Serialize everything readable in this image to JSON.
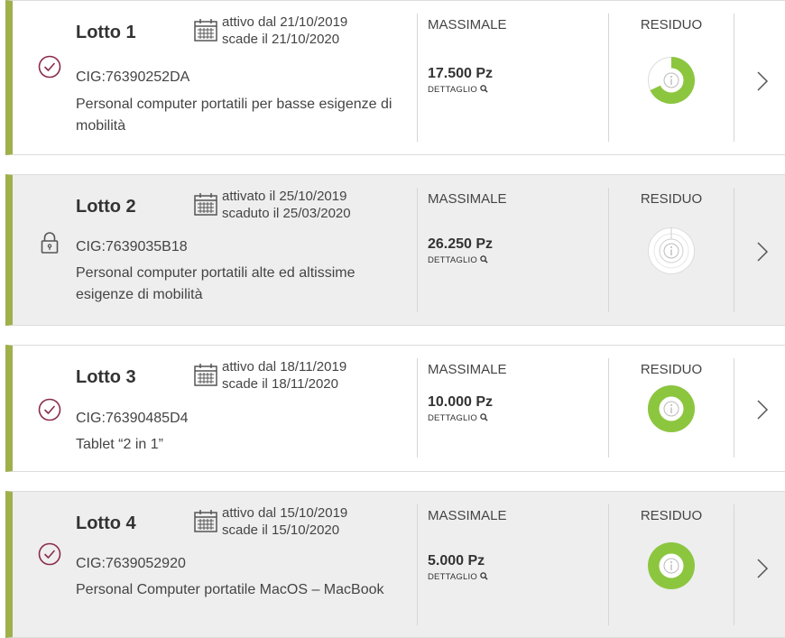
{
  "colors": {
    "accent_bar": "#9fb04b",
    "residuo_green": "#8cc63f",
    "residuo_empty": "#e6e6e6",
    "status_icon": "#8b2a4a"
  },
  "lots": [
    {
      "title": "Lotto 1",
      "status": "active",
      "status_icon": "check-circle-icon",
      "date_line1": "attivo dal 21/10/2019",
      "date_line2": "scade il 21/10/2020",
      "cig": "CIG:76390252DA",
      "description": "Personal computer portatili per basse esigenze di mobilità",
      "massimale_label": "MASSIMALE",
      "massimale_value": "17.500 Pz",
      "detail_label": "DETTAGLIO",
      "residuo_label": "RESIDUO",
      "residuo_fraction": 0.68
    },
    {
      "title": "Lotto 2",
      "status": "locked",
      "status_icon": "lock-icon",
      "date_line1": "attivato il 25/10/2019",
      "date_line2": "scaduto il 25/03/2020",
      "cig": "CIG:7639035B18",
      "description": "Personal computer portatili alte ed altissime esigenze di mobilità",
      "massimale_label": "MASSIMALE",
      "massimale_value": "26.250 Pz",
      "detail_label": "DETTAGLIO",
      "residuo_label": "RESIDUO",
      "residuo_fraction": 0.0
    },
    {
      "title": "Lotto 3",
      "status": "active",
      "status_icon": "check-circle-icon",
      "date_line1": "attivo dal 18/11/2019",
      "date_line2": "scade il 18/11/2020",
      "cig": "CIG:76390485D4",
      "description": "Tablet “2 in 1”",
      "massimale_label": "MASSIMALE",
      "massimale_value": "10.000 Pz",
      "detail_label": "DETTAGLIO",
      "residuo_label": "RESIDUO",
      "residuo_fraction": 1.0
    },
    {
      "title": "Lotto 4",
      "status": "active",
      "status_icon": "check-circle-icon",
      "date_line1": "attivo dal 15/10/2019",
      "date_line2": "scade il 15/10/2020",
      "cig": "CIG:7639052920",
      "description": "Personal Computer portatile MacOS – MacBook",
      "massimale_label": "MASSIMALE",
      "massimale_value": "5.000 Pz",
      "detail_label": "DETTAGLIO",
      "residuo_label": "RESIDUO",
      "residuo_fraction": 1.0
    }
  ]
}
